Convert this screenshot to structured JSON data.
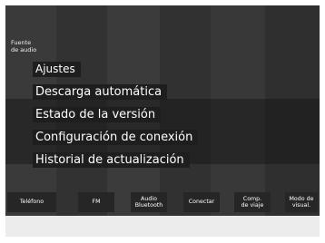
{
  "source": {
    "label_line1": "Fuente",
    "label_line2": "de audio"
  },
  "menu": {
    "items": [
      {
        "label": "Ajustes"
      },
      {
        "label": "Descarga automática"
      },
      {
        "label": "Estado de la versión"
      },
      {
        "label": "Configuración de conexión"
      },
      {
        "label": "Historial de actualización"
      }
    ]
  },
  "soft_keys": [
    {
      "line1": "Teléfono",
      "line2": ""
    },
    {
      "line1": "FM",
      "line2": ""
    },
    {
      "line1": "Audio",
      "line2": "Bluetooth"
    },
    {
      "line1": "Conectar",
      "line2": ""
    },
    {
      "line1": "Comp.",
      "line2": "de viaje"
    },
    {
      "line1": "Modo de",
      "line2": "visual."
    }
  ]
}
